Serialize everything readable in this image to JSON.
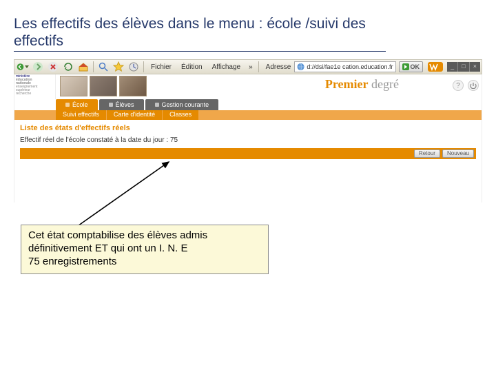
{
  "slide": {
    "title": "Les effectifs des élèves dans le menu : école /suivi des effectifs"
  },
  "toolbar": {
    "menus": {
      "file": "Fichier",
      "edit": "Édition",
      "view": "Affichage"
    },
    "address_label": "Adresse",
    "address_value": "d://dsi/fae1e cation.education.fr",
    "ok_label": "OK"
  },
  "brand": {
    "p1": "Premier",
    "p2": " degré"
  },
  "ministry": {
    "l1": "ministère",
    "l2": "éducation",
    "l3": "nationale",
    "l4": "enseignement",
    "l5": "supérieur",
    "l6": "recherche"
  },
  "tabs": {
    "items": [
      {
        "label": "École",
        "active": true
      },
      {
        "label": "Élèves",
        "active": false
      },
      {
        "label": "Gestion courante",
        "active": false
      }
    ]
  },
  "subtabs": {
    "items": [
      {
        "label": "Suivi effectifs"
      },
      {
        "label": "Carte d'identité"
      },
      {
        "label": "Classes"
      }
    ]
  },
  "page": {
    "breadcrumb": "Liste des états d'effectifs réels",
    "body_line": "Effectif réel de l'école constaté à la date du jour : 75",
    "buttons": {
      "retour": "Retour",
      "nouveau": "Nouveau"
    }
  },
  "callout": {
    "l1": "Cet état comptabilise des élèves admis",
    "l2": "définitivement ET qui ont un I. N. E",
    "l3": "75 enregistrements"
  },
  "wincontrols": {
    "min": "_",
    "max": "□",
    "close": "×"
  }
}
